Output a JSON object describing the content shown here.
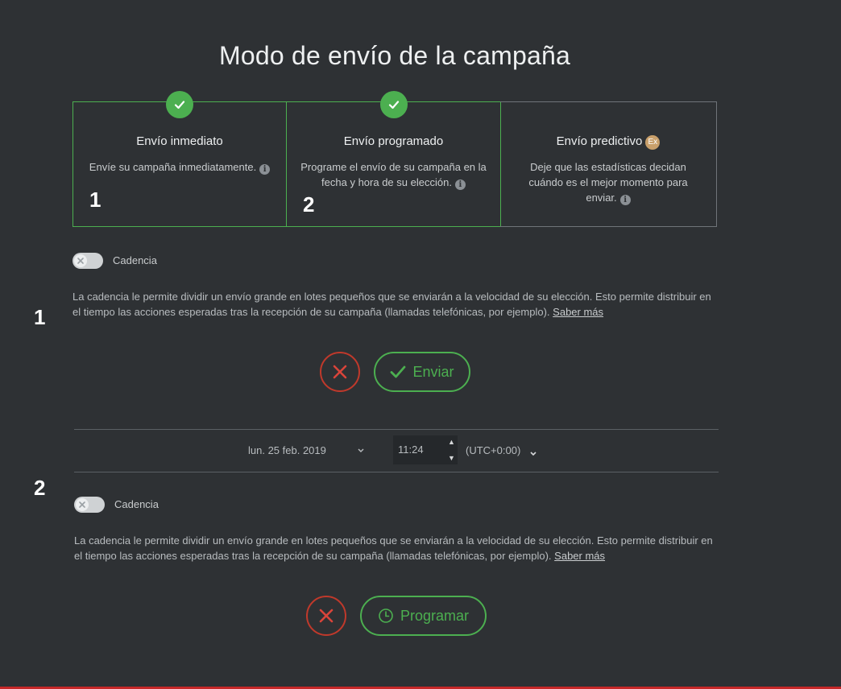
{
  "page_title": "Modo de envío de la campaña",
  "cards": [
    {
      "title": "Envío inmediato",
      "desc": "Envíe su campaña inmediatamente.",
      "checked": true
    },
    {
      "title": "Envío programado",
      "desc": "Programe el envío de su campaña en la fecha y hora de su elección.",
      "checked": true
    },
    {
      "title": "Envío predictivo",
      "badge": "Ex",
      "desc": "Deje que las estadísticas decidan cuándo es el mejor momento para enviar.",
      "checked": false
    }
  ],
  "markers": {
    "one": "1",
    "two": "2"
  },
  "section1": {
    "toggle_label": "Cadencia",
    "description": "La cadencia le permite dividir un envío grande en lotes pequeños que se enviarán a la velocidad de su elección. Esto permite distribuir en el tiempo las acciones esperadas tras la recepción de su campaña (llamadas telefónicas, por ejemplo).",
    "link": "Saber más",
    "confirm_label": "Enviar"
  },
  "section2": {
    "date": "lun. 25 feb. 2019",
    "time": "11:24",
    "timezone": "(UTC+0:00)",
    "toggle_label": "Cadencia",
    "description": "La cadencia le permite dividir un envío grande en lotes pequeños que se enviarán a la velocidad de su elección. Esto permite distribuir en el tiempo las acciones esperadas tras la recepción de su campaña (llamadas telefónicas, por ejemplo).",
    "link": "Saber más",
    "confirm_label": "Programar"
  },
  "colors": {
    "background": "#2e3134",
    "accent_green": "#4caf50",
    "cancel_red": "#c0392b",
    "badge_gold": "#c9a06b"
  },
  "icons": {
    "check": "check-icon",
    "info": "info-icon",
    "close": "close-icon",
    "clock": "clock-icon",
    "chevron": "chevron-down-icon"
  }
}
